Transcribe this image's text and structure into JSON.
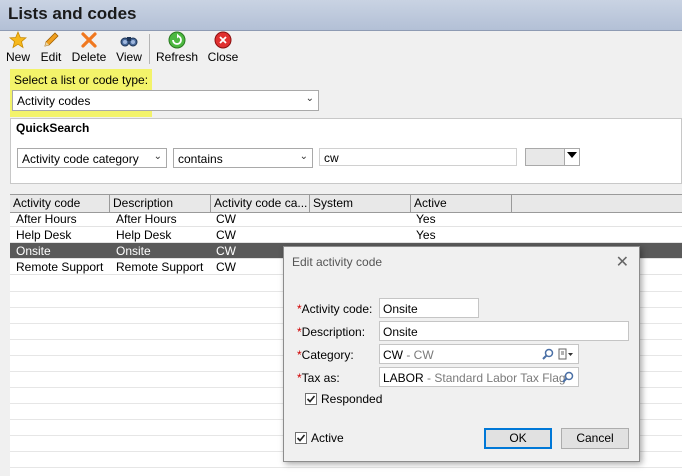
{
  "window": {
    "title": "Lists and codes"
  },
  "toolbar": {
    "new_label": "New",
    "edit_label": "Edit",
    "delete_label": "Delete",
    "view_label": "View",
    "refresh_label": "Refresh",
    "close_label": "Close",
    "icons": [
      "star-icon",
      "pencil-icon",
      "delete-x-icon",
      "binoculars-icon",
      "refresh-icon",
      "close-icon"
    ]
  },
  "selector": {
    "label": "Select a list or code type:",
    "value": "Activity codes"
  },
  "quicksearch": {
    "title": "QuickSearch",
    "field": "Activity code category",
    "operator": "contains",
    "value": "cw",
    "extra": ""
  },
  "table": {
    "columns": [
      "Activity code",
      "Description",
      "Activity code ca...",
      "System",
      "Active"
    ],
    "rows": [
      [
        "After Hours",
        "After Hours",
        "CW",
        "",
        "Yes"
      ],
      [
        "Help Desk",
        "Help Desk",
        "CW",
        "",
        "Yes"
      ],
      [
        "Onsite",
        "Onsite",
        "CW",
        "",
        ""
      ],
      [
        "Remote Support",
        "Remote Support",
        "CW",
        "",
        ""
      ]
    ]
  },
  "dialog": {
    "title": "Edit activity code",
    "required_mark": "*",
    "activity_code_label": "Activity code:",
    "activity_code_value": "Onsite",
    "description_label": "Description:",
    "description_value": "Onsite",
    "category_label": "Category:",
    "category_code": "CW",
    "category_desc": " - CW",
    "tax_label": "Tax as:",
    "tax_code": "LABOR",
    "tax_desc": " - Standard Labor Tax Flag",
    "responded_label": "Responded",
    "responded_checked": true,
    "active_label": "Active",
    "active_checked": true,
    "ok_label": "OK",
    "cancel_label": "Cancel"
  },
  "colors": {
    "highlight": "#f3f36a",
    "selected_row": "#5a5a5a",
    "required": "#d00000"
  }
}
